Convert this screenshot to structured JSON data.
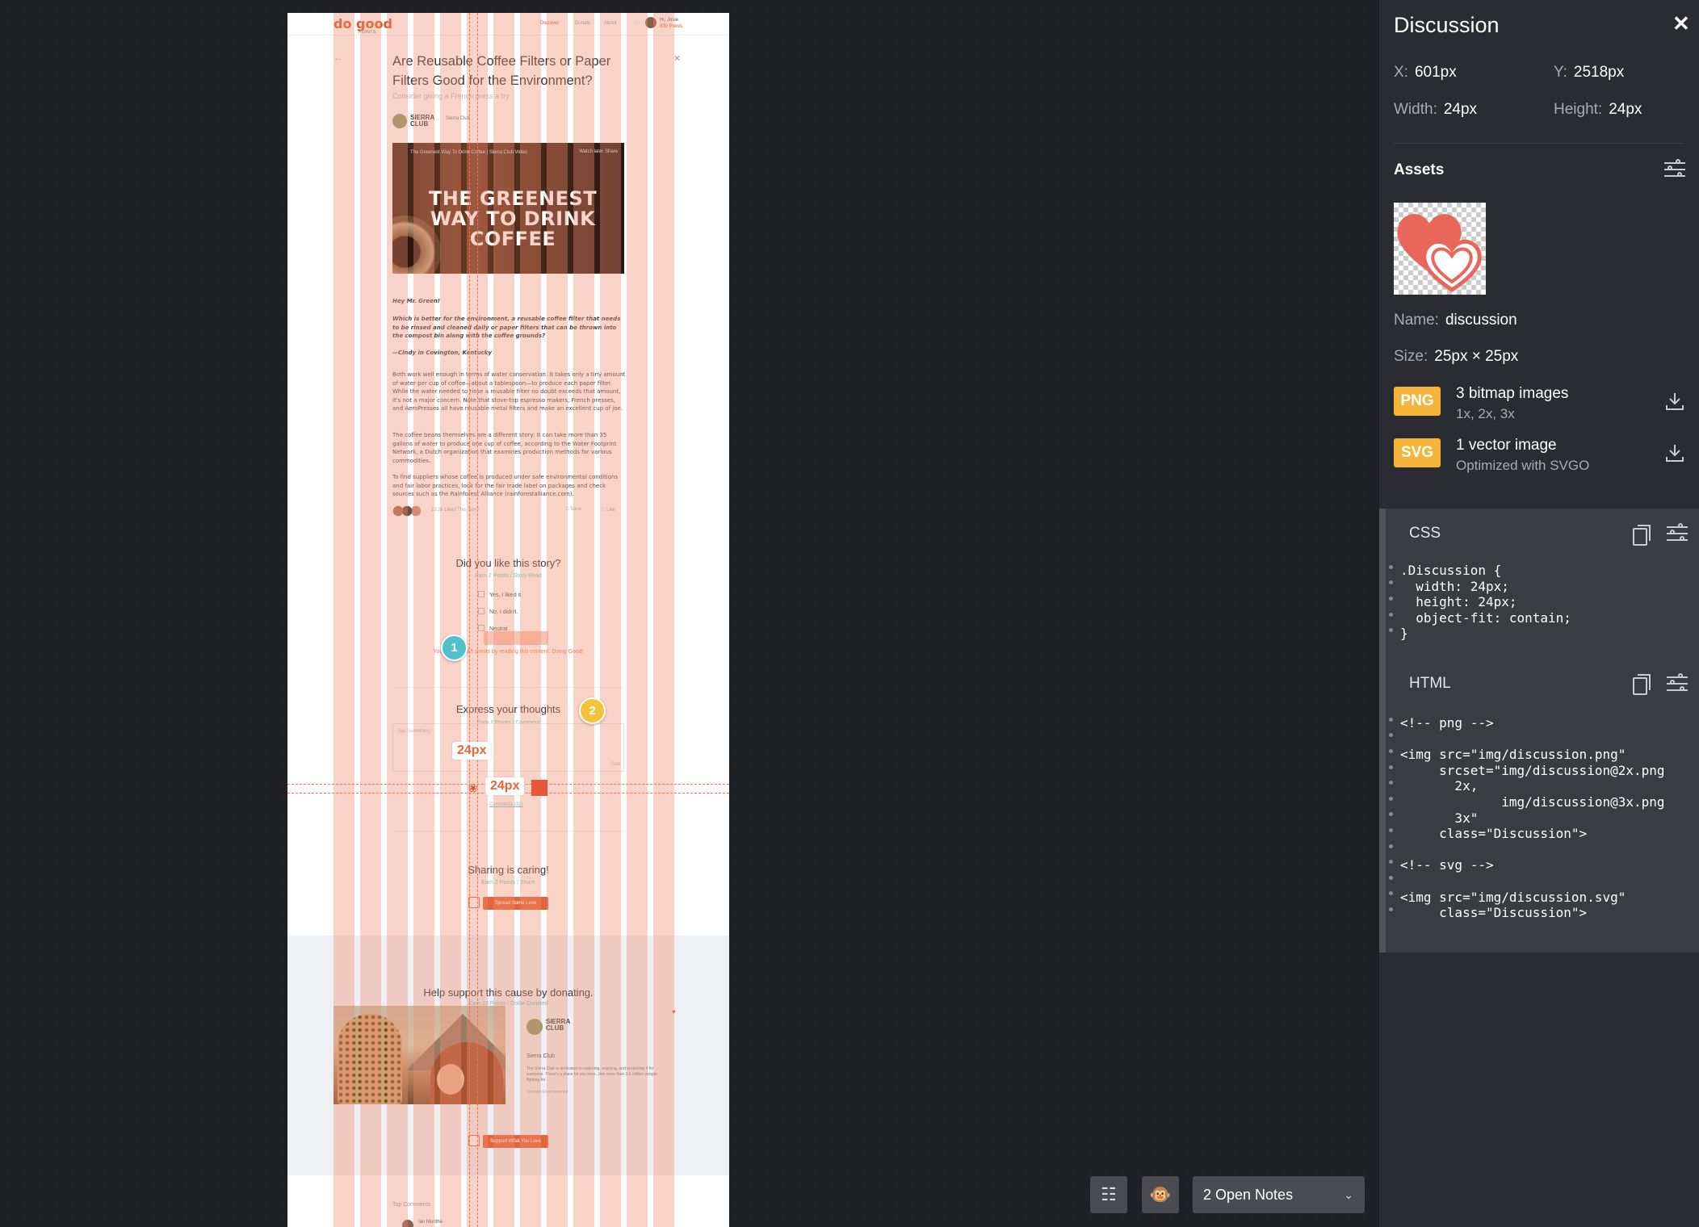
{
  "artboard": {
    "nav": {
      "logo": "do good",
      "logo_sub": "POINTS",
      "items": [
        "Discover",
        "Donate",
        "About"
      ],
      "greeting": "Hi, Josie",
      "points": "830 Points"
    },
    "article": {
      "title": "Are Reusable Coffee Filters or Paper Filters Good for the Environment?",
      "subtitle": "Consider giving a French press a try",
      "org_name": "SIERRA CLUB",
      "org_meta": "Sierra Club",
      "video_caption": "The Greenest Way To Drink Coffee | Sierra Club Video",
      "video_actions": "Watch later   Share",
      "video_title": "THE GREENEST WAY TO DRINK COFFEE",
      "greeting": "Hey Mr. Green!",
      "question": "Which is better for the environment, a reusable coffee filter that needs to be rinsed and cleaned daily or paper filters that can be thrown into the compost bin along with the coffee grounds?",
      "signature": "—Cindy in Covington, Kentucky",
      "p1": "Both work well enough in terms of water conservation. It takes only a tiny amount of water per cup of coffee—about a tablespoon—to produce each paper filter. While the water needed to rinse a reusable filter no doubt exceeds that amount, it's not a major concern. Note that stove-top espresso makers, French presses, and AeroPresses all have reusable metal filters and make an excellent cup of joe.",
      "p2": "The coffee beans themselves are a different story: It can take more than 35 gallons of water to produce one cup of coffee, according to the Water Footprint Network, a Dutch organization that examines production methods for various commodities.",
      "p3": "To find suppliers whose coffee is produced under safe environmental conditions and fair labor practices, look for the fair trade label on packages and check sources such as the Rainforest Alliance (rainforestalliance.com).",
      "likes": "12.2k Liked This Story",
      "save": "Save",
      "like": "Like"
    },
    "survey": {
      "title": "Did you like this story?",
      "earn": "Earn 2 Points / Story Read",
      "options": [
        "Yes, I liked it.",
        "No, I didn't.",
        "Neutral"
      ],
      "earned": "You've earned 5 points by reading this content. Doing Good!"
    },
    "thoughts": {
      "title": "Express your thoughts",
      "earn": "Earn 2 Points / Comment",
      "placeholder": "Say Something",
      "post": "Post",
      "comments_link": "Comments (32)"
    },
    "sharing": {
      "title": "Sharing is caring!",
      "earn": "Earn 2 Points / Share",
      "button": "Spread Some Love"
    },
    "donate": {
      "title": "Help support this cause by donating.",
      "earn": "Earn 10 Points / Dollar Donated",
      "org_name": "SIERRA CLUB",
      "org_title": "Sierra Club",
      "org_desc": "The Sierra Club is dedicated to exploring, enjoying, and protecting it for everyone. There's a place for you here. Join more than 3.5 million people fighting for...",
      "org_meta": "Website   Environmental",
      "button": "Support What You Love"
    },
    "top_comments": {
      "title": "Top Comments",
      "first_name": "Ian Munthe"
    }
  },
  "overlay": {
    "measure_upper": "24px",
    "measure_lower": "24px",
    "pins": [
      "1",
      "2"
    ],
    "pin_colors": [
      "#4fc2c9",
      "#f5c23a"
    ]
  },
  "toolbar": {
    "notes_label": "2 Open Notes",
    "note_icon": "add-note-icon",
    "avatar_icon": "monkey-avatar-icon"
  },
  "inspector": {
    "title": "Discussion",
    "x_label": "X:",
    "x_value": "601px",
    "y_label": "Y:",
    "y_value": "2518px",
    "width_label": "Width:",
    "width_value": "24px",
    "height_label": "Height:",
    "height_value": "24px",
    "assets_title": "Assets",
    "name_label": "Name:",
    "name_value": "discussion",
    "size_label": "Size:",
    "size_value": "25px × 25px",
    "png_badge": "PNG",
    "png_title": "3 bitmap images",
    "png_sub": "1x, 2x, 3x",
    "svg_badge": "SVG",
    "svg_title": "1 vector image",
    "svg_sub": "Optimized with SVGO",
    "css_title": "CSS",
    "css_code": ".Discussion {\n  width: 24px;\n  height: 24px;\n  object-fit: contain;\n}",
    "html_title": "HTML",
    "html_code": "<!-- png -->\n\n<img src=\"img/discussion.png\"\n     srcset=\"img/discussion@2x.png\n       2x,\n             img/discussion@3x.png\n       3x\"\n     class=\"Discussion\">\n\n<!-- svg -->\n\n<img src=\"img/discussion.svg\"\n     class=\"Discussion\">"
  },
  "colors": {
    "accent": "#e4643c",
    "badge": "#f5b43a",
    "panel": "#2b2c31",
    "canvas": "#1f2024"
  }
}
